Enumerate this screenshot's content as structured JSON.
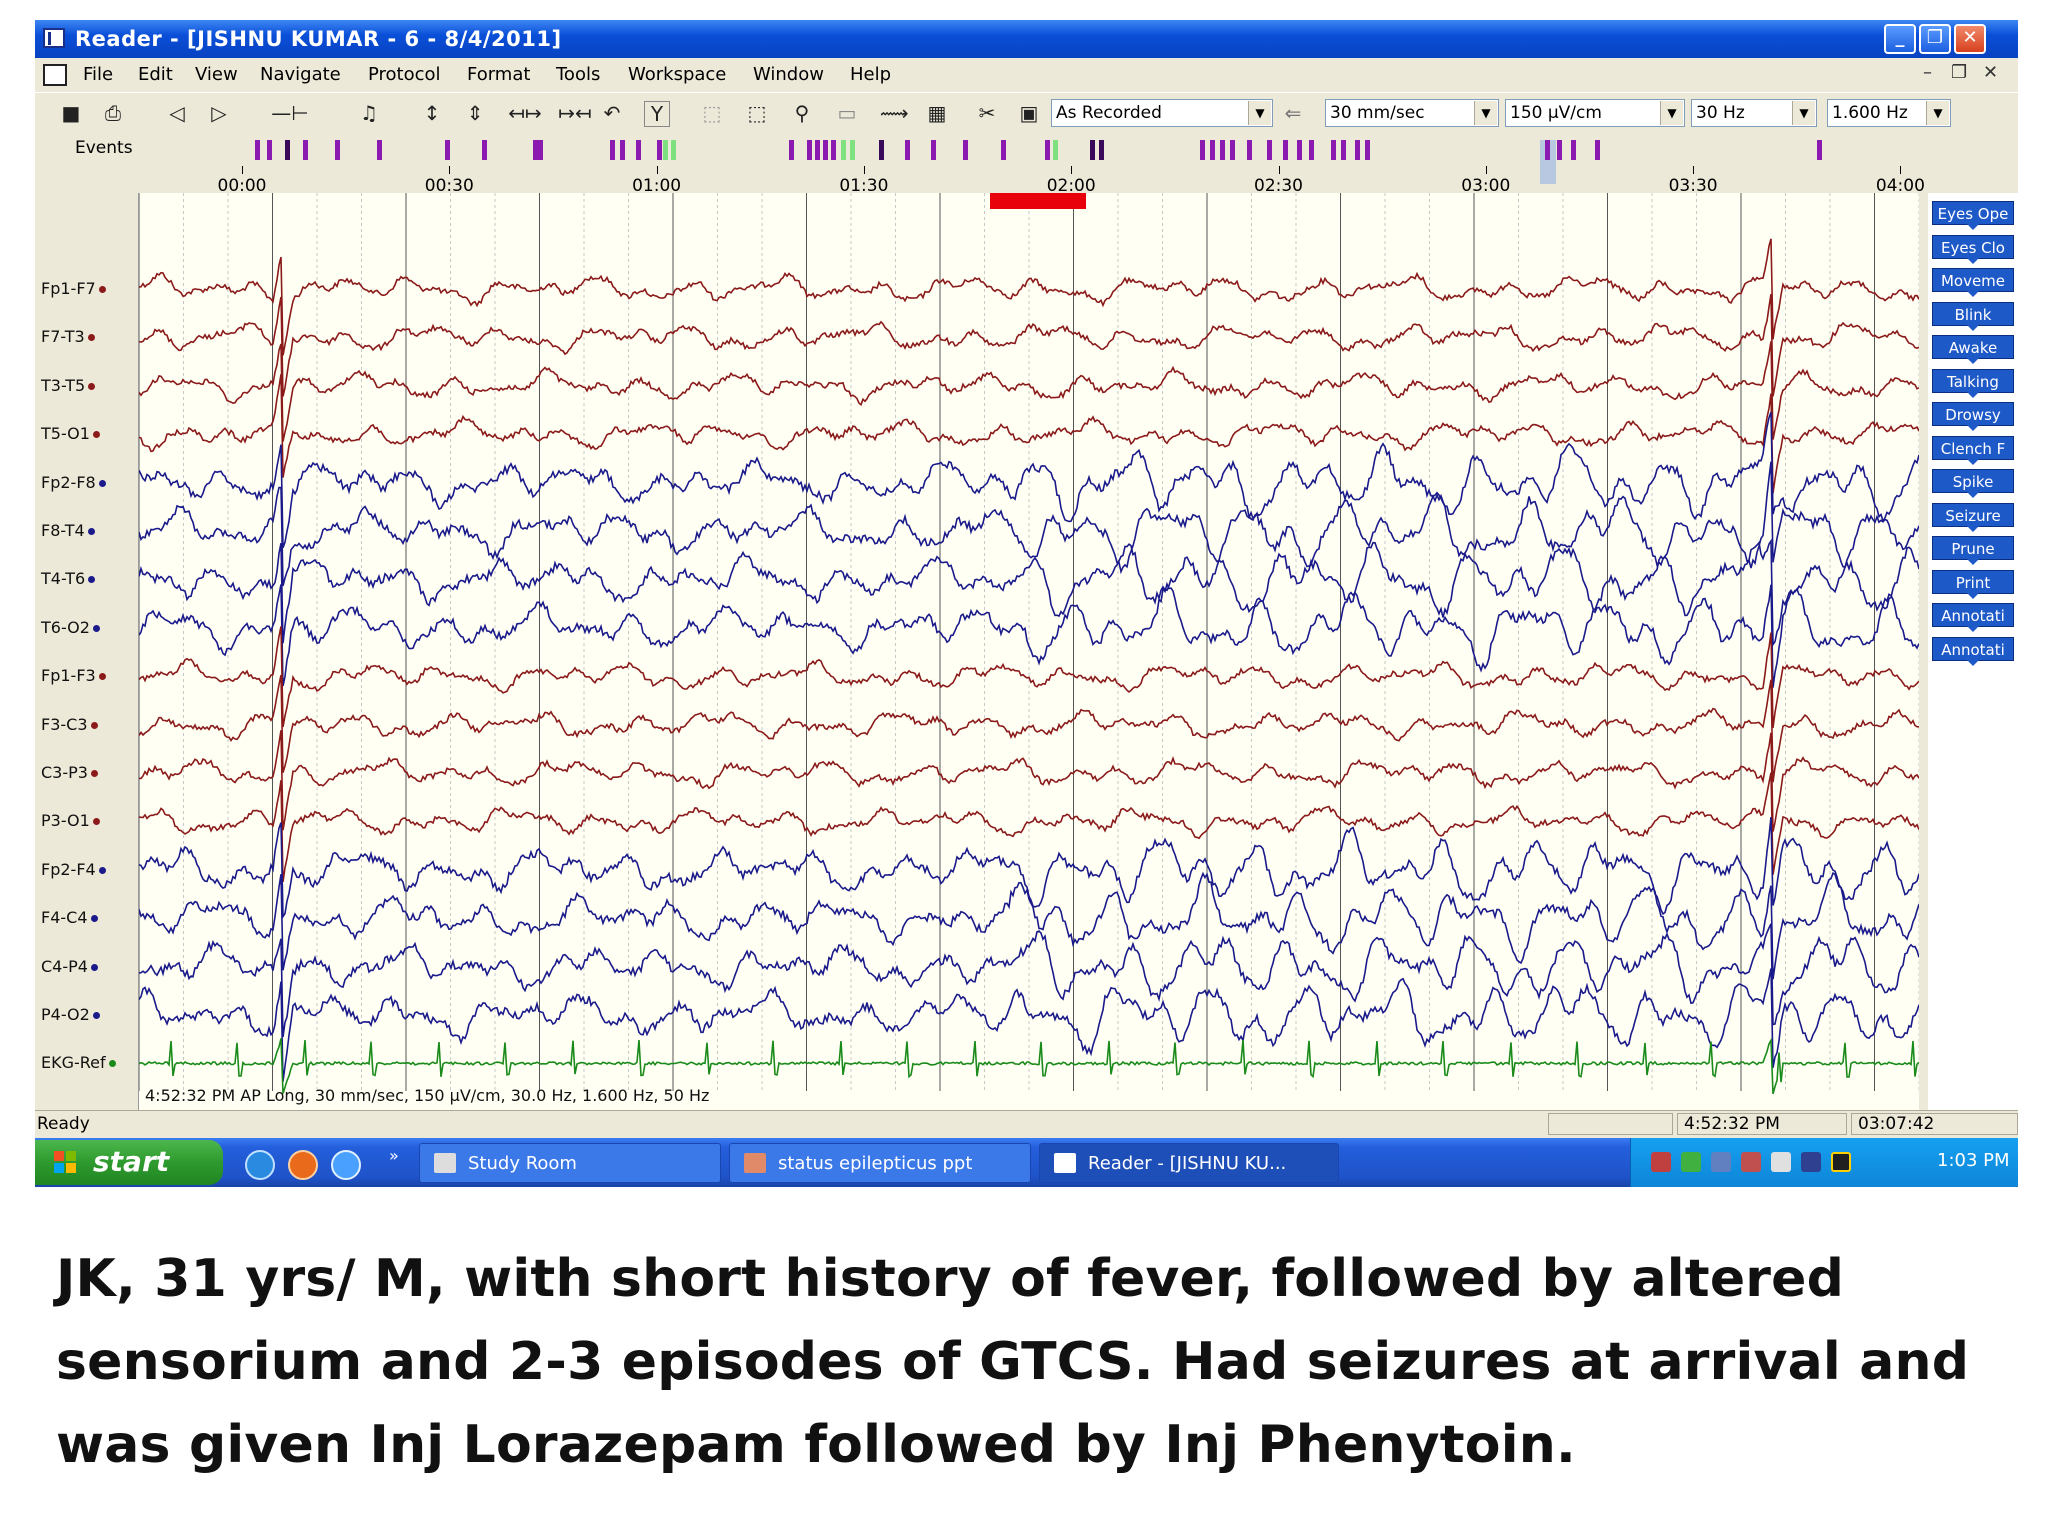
{
  "window": {
    "title": "Reader - [JISHNU KUMAR - 6 - 8/4/2011]"
  },
  "menu": {
    "items": [
      "File",
      "Edit",
      "View",
      "Navigate",
      "Protocol",
      "Format",
      "Tools",
      "Workspace",
      "Window",
      "Help"
    ]
  },
  "toolbar": {
    "montage": "As Recorded",
    "paper_speed": "30 mm/sec",
    "sensitivity": "150 µV/cm",
    "high_filter": "30 Hz",
    "low_filter": "1.600 Hz"
  },
  "events_label": "Events",
  "timeline": {
    "ticks": [
      "00:00",
      "00:30",
      "01:00",
      "01:30",
      "02:00",
      "02:30",
      "03:00",
      "03:30",
      "04:00"
    ]
  },
  "event_marker_colors": {
    "purple": "#8a1ab0",
    "green": "#7fe07f",
    "dark": "#3a0a5a"
  },
  "channels": [
    {
      "label": "Fp1-F7",
      "color": "#8b1a1a",
      "group": "left"
    },
    {
      "label": "F7-T3",
      "color": "#8b1a1a",
      "group": "left"
    },
    {
      "label": "T3-T5",
      "color": "#8b1a1a",
      "group": "left"
    },
    {
      "label": "T5-O1",
      "color": "#8b1a1a",
      "group": "left"
    },
    {
      "label": "Fp2-F8",
      "color": "#1a1a8b",
      "group": "right"
    },
    {
      "label": "F8-T4",
      "color": "#1a1a8b",
      "group": "right"
    },
    {
      "label": "T4-T6",
      "color": "#1a1a8b",
      "group": "right"
    },
    {
      "label": "T6-O2",
      "color": "#1a1a8b",
      "group": "right"
    },
    {
      "label": "Fp1-F3",
      "color": "#8b1a1a",
      "group": "left"
    },
    {
      "label": "F3-C3",
      "color": "#8b1a1a",
      "group": "left"
    },
    {
      "label": "C3-P3",
      "color": "#8b1a1a",
      "group": "left"
    },
    {
      "label": "P3-O1",
      "color": "#8b1a1a",
      "group": "left"
    },
    {
      "label": "Fp2-F4",
      "color": "#1a1a8b",
      "group": "right"
    },
    {
      "label": "F4-C4",
      "color": "#1a1a8b",
      "group": "right"
    },
    {
      "label": "C4-P4",
      "color": "#1a1a8b",
      "group": "right"
    },
    {
      "label": "P4-O2",
      "color": "#1a1a8b",
      "group": "right"
    },
    {
      "label": "EKG-Ref",
      "color": "#1a8b1a",
      "group": "ekg"
    }
  ],
  "eeg_footer": "4:52:32 PM AP Long, 30 mm/sec, 150 µV/cm, 30.0 Hz, 1.600 Hz, 50 Hz",
  "event_buttons": [
    "Eyes Ope",
    "Eyes Clo",
    "Moveme",
    "Blink",
    "Awake",
    "Talking",
    "Drowsy",
    "Clench F",
    "Spike",
    "Seizure",
    "Prune",
    "Print",
    "Annotati",
    "Annotati"
  ],
  "status": {
    "ready": "Ready",
    "clock_time": "4:52:32 PM",
    "elapsed": "03:07:42"
  },
  "taskbar": {
    "start": "start",
    "tasks": [
      "Study Room",
      "status epilepticus ppt",
      "Reader - [JISHNU KU..."
    ],
    "clock": "1:03 PM"
  },
  "caption": "JK, 31 yrs/ M, with short history of fever, followed by altered sensorium and 2-3 episodes of GTCS. Had seizures at arrival and was given Inj Lorazepam followed by Inj Phenytoin."
}
